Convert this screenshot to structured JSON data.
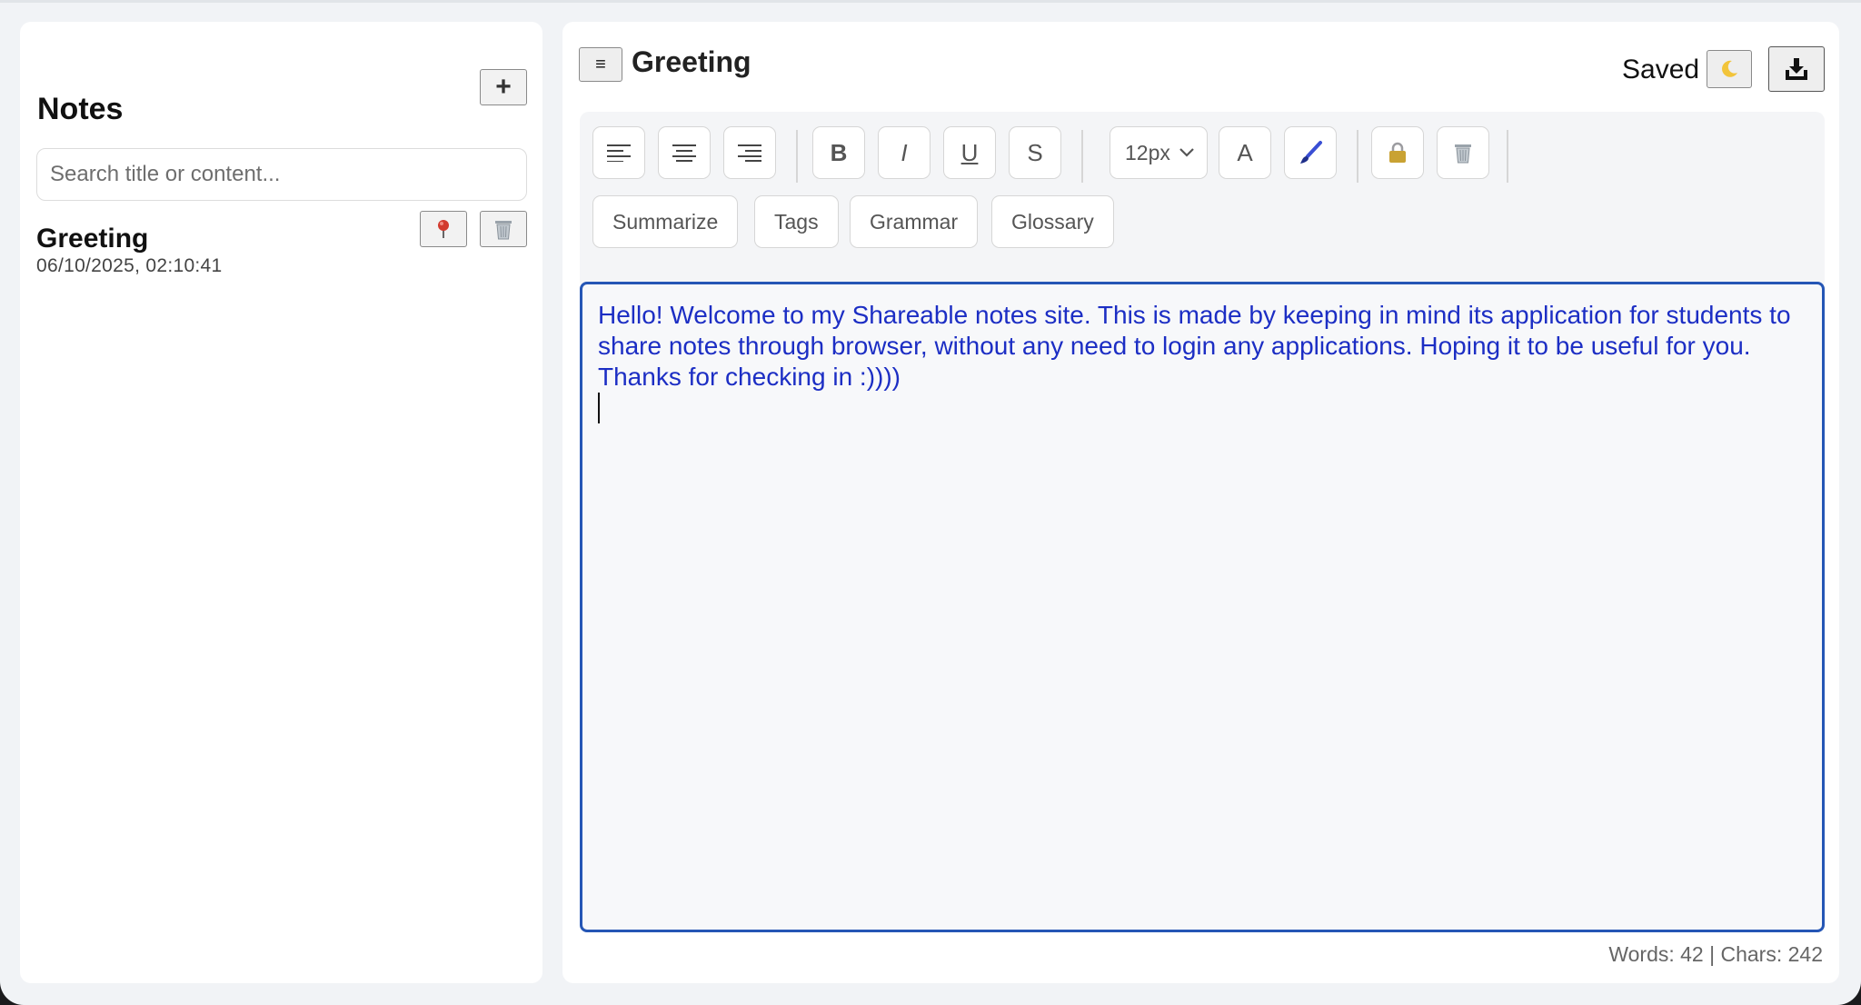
{
  "sidebar": {
    "title": "Notes",
    "add_label": "+",
    "search_placeholder": "Search title or content...",
    "notes": [
      {
        "title": "Greeting",
        "date": "06/10/2025, 02:10:41"
      }
    ]
  },
  "header": {
    "menu_label": "≡",
    "title": "Greeting",
    "status": "Saved"
  },
  "toolbar": {
    "bold": "B",
    "italic": "I",
    "underline": "U",
    "strike": "S",
    "font_size": "12px",
    "font_color": "A",
    "ai_actions": [
      "Summarize",
      "Tags",
      "Grammar",
      "Glossary"
    ]
  },
  "editor": {
    "content": "Hello! Welcome to my Shareable notes site. This is made by keeping in mind its application for students to share notes through browser, without any need to login any applications. Hoping it to be useful for you. Thanks for checking in :))))"
  },
  "footer": {
    "stats": "Words: 42 | Chars: 242"
  },
  "colors": {
    "accent": "#2556b5",
    "editor_text": "#1c2ec4"
  }
}
